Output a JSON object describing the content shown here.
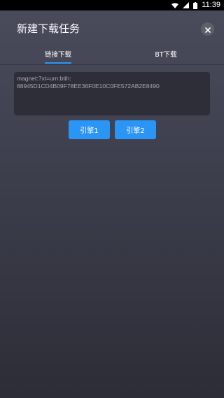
{
  "status_bar": {
    "time": "11:39",
    "icons": [
      "wifi-icon",
      "signal-icon",
      "battery-icon"
    ]
  },
  "dialog": {
    "title": "新建下载任务",
    "close_icon": "close-icon"
  },
  "tabs": [
    {
      "label": "链接下载",
      "active": true
    },
    {
      "label": "BT下载",
      "active": false
    }
  ],
  "link_input": {
    "value": "magnet:?xt=urn:btih:\n88945D1CD4B09F78EE36F0E10C0FE572AB2E8490"
  },
  "buttons": {
    "engine1": "引擎1",
    "engine2": "引擎2"
  },
  "colors": {
    "accent": "#2b95f5",
    "background_top": "#4a4c5c",
    "background_bottom": "#2c2d36",
    "input_background": "#2d2e38",
    "close_button_bg": "#5d5f6b"
  }
}
